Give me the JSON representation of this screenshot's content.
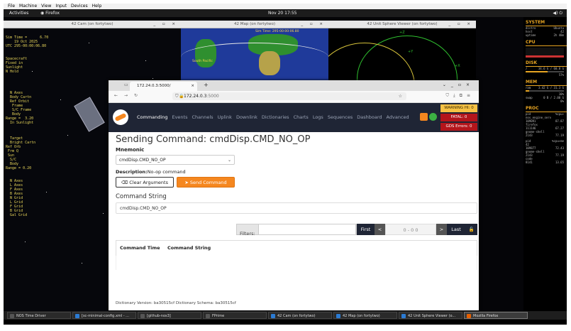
{
  "vm_menu": [
    "File",
    "Machine",
    "View",
    "Input",
    "Devices",
    "Help"
  ],
  "topbar": {
    "activities": "Activities",
    "app": "Firefox",
    "clock": "Nov 20  17:55",
    "tray": "◀)  ⏻"
  },
  "windows": [
    {
      "title": "42 Cam (on fortytwo)",
      "controls": "_ ▫ ×"
    },
    {
      "title": "42 Map (on fortytwo)",
      "controls": "_ ▫ ×"
    },
    {
      "title": "42 Unit Sphere Viewer (on fortytwo)",
      "controls": "_ ▫ ×"
    }
  ],
  "cam_hud": {
    "top": [
      "Sim Time =      6.70",
      "    19 Oct 2025",
      "UTC 295-00:00:06.80"
    ],
    "mid": [
      "Spacecraft",
      "Fixed in",
      "Sunlight",
      "N Hold"
    ],
    "left": [
      "  N Axes",
      "  Body Cartn",
      "  Ref Orbit",
      "   Frame",
      "   S/C Frame",
      "   Body",
      "Range =  3.20",
      "  In Sunlight"
    ],
    "low": [
      "  Target",
      "  Bright Cartn",
      "Ref Orb",
      " Frm Q",
      " Sun",
      "  S/C",
      "  Body",
      "Range = 0.20"
    ],
    "bottom": [
      "  N Axes",
      "  L Axes",
      "  F Axes",
      "  B Axes",
      "  N Grid",
      "  L Grid",
      "  F Grid",
      "  B Grid",
      "  Gal Grid"
    ]
  },
  "map_labels": [
    "Sim Time: 295-00:00:06.80",
    "South Pacific"
  ],
  "sphere_labels": [
    "+Z",
    "+Y",
    "+X"
  ],
  "conky": {
    "system": {
      "title": "SYSTEM",
      "rows": [
        [
          "distro",
          "Ubuntu"
        ],
        [
          "host",
          "42"
        ],
        [
          "uptime",
          "2h 48m"
        ]
      ]
    },
    "cpu": {
      "title": "CPU"
    },
    "disk": {
      "title": "DISK",
      "rows": [
        [
          "/",
          "34.6 G / 60.8 G"
        ]
      ],
      "percent": "57%",
      "fill": 57
    },
    "mem": {
      "title": "MEM",
      "rows": [
        [
          "ram",
          "3.42 G / 31.3 G"
        ]
      ],
      "percent": "10%",
      "fill": 10,
      "swap": [
        "swap",
        "0 B / 2.00 G"
      ],
      "swap_percent": "0%"
    },
    "proc": {
      "title": "PROC",
      "header": [
        "pid",
        "%cpu▾"
      ],
      "rows": [
        [
          "nos_engine_serv",
          ""
        ],
        [
          "109091",
          "87.87"
        ],
        [
          "firefox",
          ""
        ],
        [
          "111146",
          "67.27"
        ],
        [
          "gnome-shell",
          ""
        ],
        [
          "2143",
          "77.19"
        ]
      ],
      "header2": [
        "pid",
        "%cpu▾me"
      ],
      "rows2": [
        [
          "42",
          ""
        ],
        [
          "109877",
          "72.43"
        ],
        [
          "gnome-shell",
          ""
        ],
        [
          "2143",
          "77.19"
        ],
        [
          "code",
          ""
        ],
        [
          "8141",
          "13.65"
        ]
      ]
    }
  },
  "taskbar": [
    {
      "label": "NOS Time Driver",
      "color": "#555555"
    },
    {
      "label": "[sc-minimal-config.xml - ...",
      "color": "#2b7bd3"
    },
    {
      "label": "[github-nos3]",
      "color": "#555555"
    },
    {
      "label": "FPrime",
      "color": "#555555"
    },
    {
      "label": "42 Cam (on fortytwo)",
      "color": "#2b7bd3"
    },
    {
      "label": "42 Map (on fortytwo)",
      "color": "#2b7bd3"
    },
    {
      "label": "42 Unit Sphere Viewer (o...",
      "color": "#2b7bd3"
    },
    {
      "label": "Mozilla Firefox",
      "color": "#e66000"
    }
  ],
  "browser": {
    "tab_title": "172.24.0.3:5000/",
    "url_host": "172.24.0.3",
    "url_port": ":5000",
    "nav": [
      "Commanding",
      "Events",
      "Channels",
      "Uplink",
      "Downlink",
      "Dictionaries",
      "Charts",
      "Logs",
      "Sequences",
      "Dashboard",
      "Advanced"
    ],
    "status": {
      "warning": "WARNING HI: 0",
      "fatal": "FATAL: 0",
      "gds": "GDS Errors: 0"
    },
    "heading": "Sending Command: cmdDisp.CMD_NO_OP",
    "mnemonic_label": "Mnemonic",
    "mnemonic_value": "cmdDisp.CMD_NO_OP",
    "description_label": "Description:",
    "description_value": "No-op command",
    "clear_button": "Clear Arguments",
    "send_button": "Send Command",
    "command_string_label": "Command String",
    "command_string_value": "cmdDisp.CMD_NO_OP",
    "filters_label": "Filters:",
    "pager": {
      "first": "First",
      "prev": "<",
      "range": "0 - 0     0",
      "next": ">",
      "last": "Last"
    },
    "columns": [
      "Command Time",
      "Command String"
    ],
    "footer": "Dictionary Version: ba30515cf Dictionary Schema: ba30515cf"
  }
}
